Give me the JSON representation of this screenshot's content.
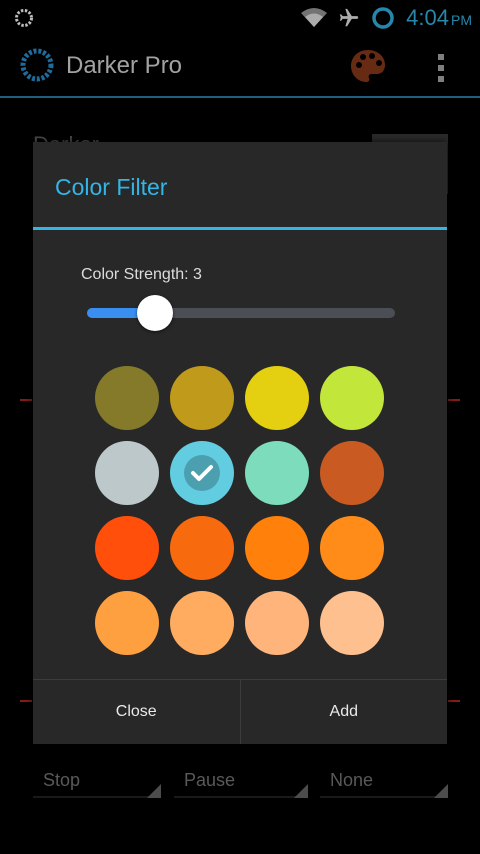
{
  "status_bar": {
    "time": "4:04",
    "ampm": "PM",
    "icons": [
      "darker-notification-icon",
      "wifi-icon",
      "airplane-mode-icon",
      "darker-status-icon"
    ]
  },
  "app": {
    "title": "Darker Pro",
    "icons": [
      "app-logo-icon",
      "palette-icon",
      "overflow-menu-icon"
    ]
  },
  "background": {
    "partial_text": "Darker",
    "spinners": [
      "Stop",
      "Pause",
      "None"
    ]
  },
  "dialog": {
    "title": "Color Filter",
    "strength_label": "Color Strength: 3",
    "strength_fraction": 0.22,
    "swatches": [
      "#847a2a",
      "#c09a1a",
      "#e4d010",
      "#c2e63a",
      "#bcc8ca",
      "#62cce0",
      "#7cdcbc",
      "#c85a22",
      "#ff4f0a",
      "#f86a0e",
      "#ff800a",
      "#ff8c18",
      "#ffa040",
      "#ffac60",
      "#ffb47c",
      "#ffc090"
    ],
    "selected_index": 5,
    "buttons": {
      "close": "Close",
      "add": "Add"
    }
  },
  "colors": {
    "accent": "#33b5e5",
    "slider_fill": "#3a8ef0",
    "dialog_bg": "#282828"
  }
}
